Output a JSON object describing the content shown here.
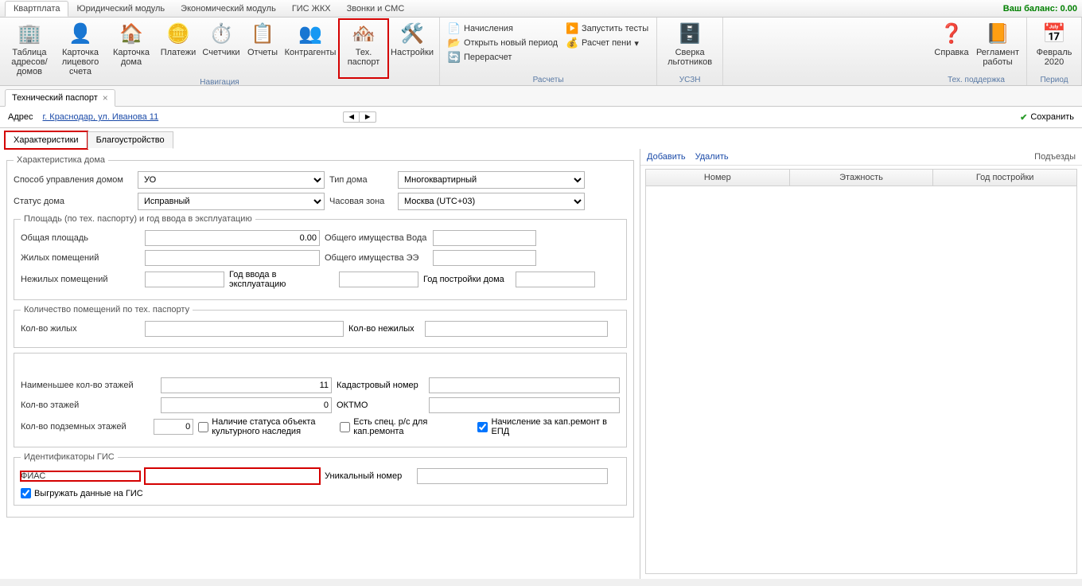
{
  "balance_label": "Ваш баланс: 0.00",
  "top_tabs": {
    "t0": "Квартплата",
    "t1": "Юридический модуль",
    "t2": "Экономический модуль",
    "t3": "ГИС ЖКХ",
    "t4": "Звонки и СМС"
  },
  "ribbon": {
    "nav": {
      "label": "Навигация",
      "b0": "Таблица адресов/домов",
      "b1": "Карточка лицевого счета",
      "b2": "Карточка дома",
      "b3": "Платежи",
      "b4": "Счетчики",
      "b5": "Отчеты",
      "b6": "Контрагенты",
      "b7": "Тех. паспорт",
      "b8": "Настройки"
    },
    "calc": {
      "label": "Расчеты",
      "i0": "Начисления",
      "i1": "Открыть новый период",
      "i2": "Перерасчет",
      "i3": "Запустить тесты",
      "i4": "Расчет пени"
    },
    "uszn": {
      "label": "УСЗН",
      "b0": "Сверка льготников"
    },
    "support": {
      "label": "Тех. поддержка",
      "b0": "Справка",
      "b1": "Регламент работы"
    },
    "period": {
      "label": "Период",
      "b0": "Февраль 2020"
    }
  },
  "doc_tab": "Технический паспорт",
  "address": {
    "label": "Адрес",
    "link": "г. Краснодар, ул. Иванова 11"
  },
  "save_label": "Сохранить",
  "subtabs": {
    "t0": "Характеристики",
    "t1": "Благоустройство"
  },
  "group_house": {
    "legend": "Характеристика дома",
    "mgmt_label": "Способ управления домом",
    "mgmt_value": "УО",
    "type_label": "Тип дома",
    "type_value": "Многоквартирный",
    "status_label": "Статус дома",
    "status_value": "Исправный",
    "tz_label": "Часовая зона",
    "tz_value": "Москва (UTC+03)"
  },
  "group_area": {
    "legend": "Площадь (по тех. паспорту) и год ввода в эксплуатацию",
    "total_label": "Общая площадь",
    "total_value": "0.00",
    "water_label": "Общего имущества Вода",
    "res_label": "Жилых помещений",
    "ee_label": "Общего имущества ЭЭ",
    "nonres_label": "Нежилых помещений",
    "year_label": "Год ввода в эксплуатацию",
    "buildyear_label": "Год постройки дома"
  },
  "group_count": {
    "legend": "Количество помещений по тех. паспорту",
    "res_label": "Кол-во жилых",
    "nonres_label": "Кол-во нежилых"
  },
  "group_floors": {
    "minfl_label": "Наименьшее кол-во этажей",
    "minfl_value": "11",
    "cad_label": "Кадастровый номер",
    "fl_label": "Кол-во этажей",
    "fl_value": "0",
    "oktmo_label": "ОКТМО",
    "under_label": "Кол-во подземных этажей",
    "under_value": "0",
    "heritage_label": "Наличие статуса объекта культурного наследия",
    "spec_label": "Есть спец. р/с для кап.ремонта",
    "epd_label": "Начисление за кап.ремонт в ЕПД"
  },
  "group_gis": {
    "legend": "Идентификаторы ГИС",
    "fias_label": "ФИАС",
    "uniq_label": "Уникальный номер",
    "export_label": "Выгружать данные на ГИС"
  },
  "right": {
    "add": "Добавить",
    "del": "Удалить",
    "title": "Подъезды",
    "col0": "Номер",
    "col1": "Этажность",
    "col2": "Год постройки"
  }
}
